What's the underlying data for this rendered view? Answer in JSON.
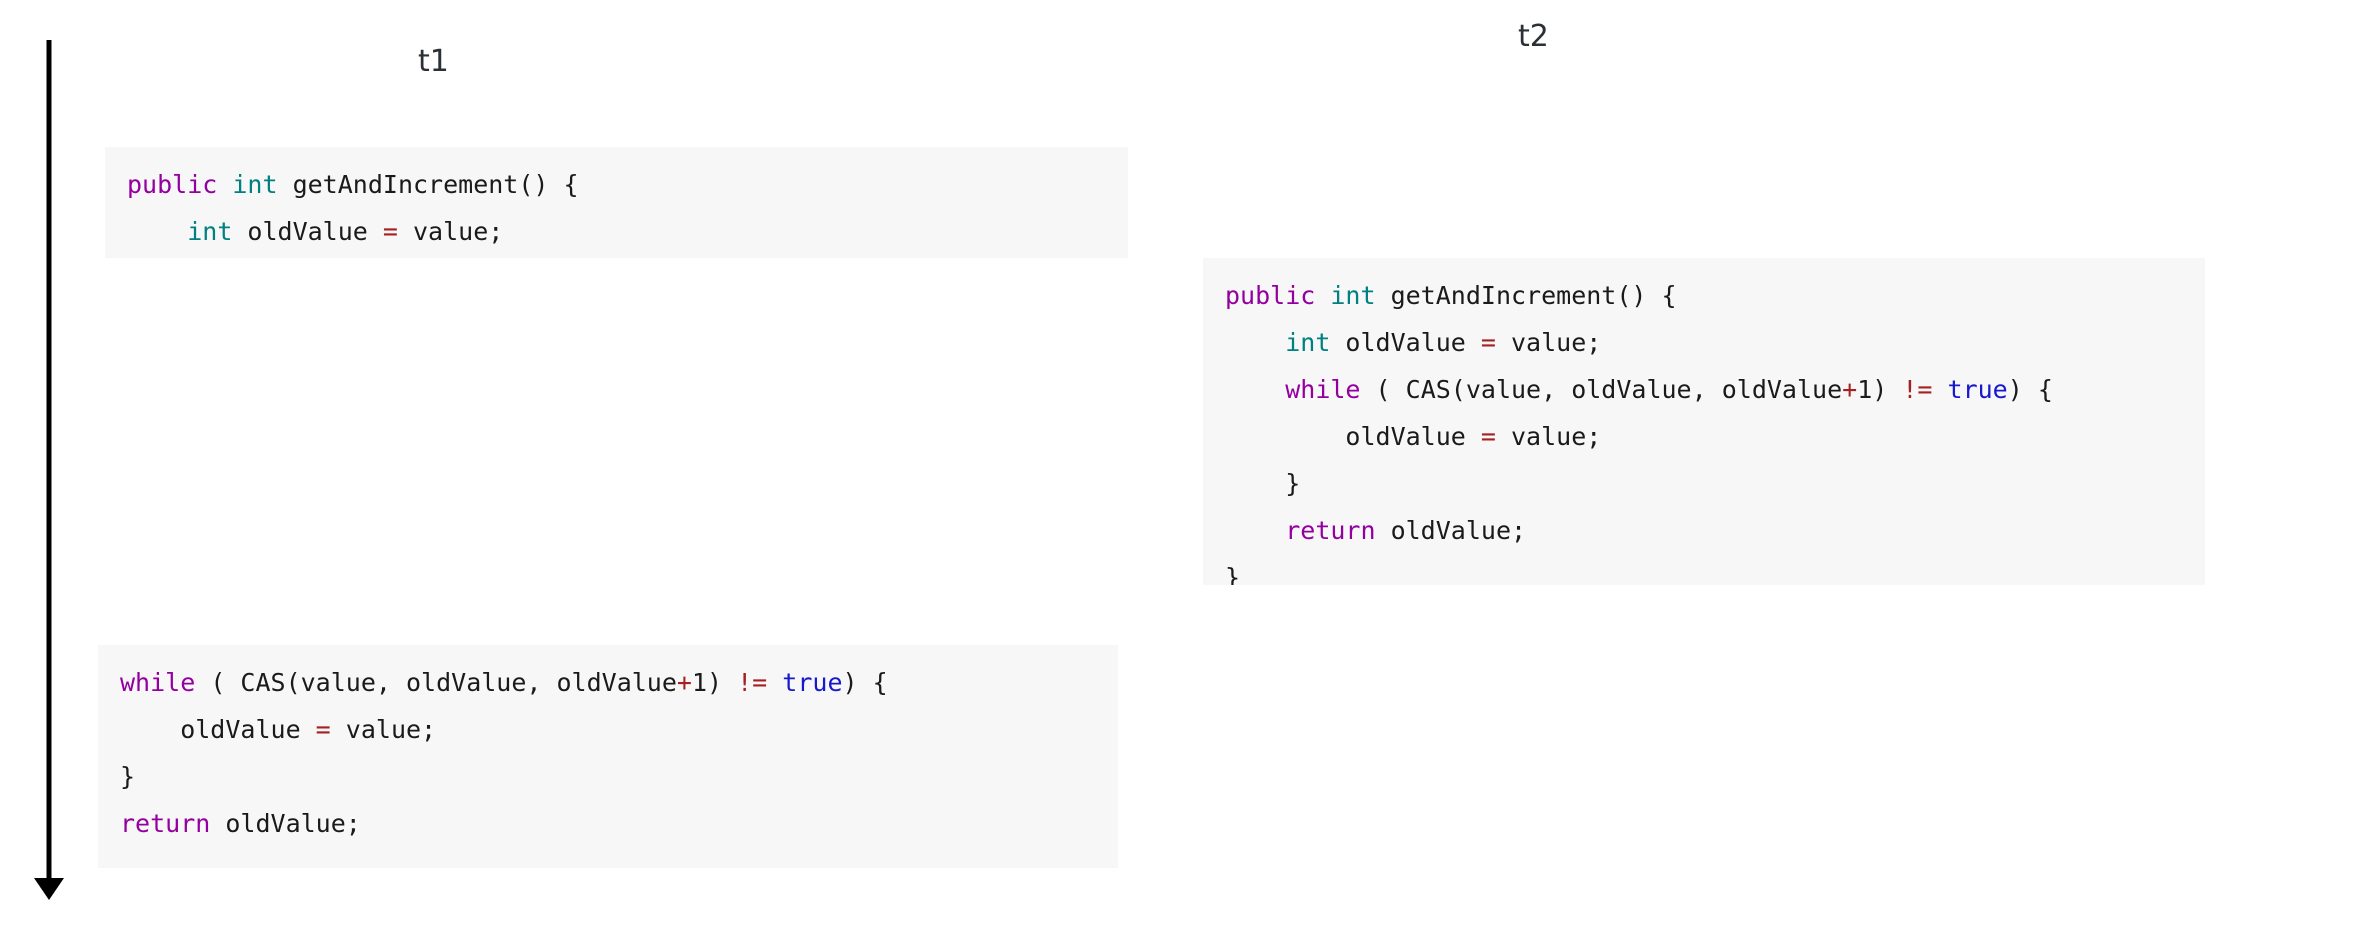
{
  "figure": {
    "type": "thread-interleaving-diagram",
    "background_color": "#ffffff",
    "code_block_background": "#f7f7f7"
  },
  "timeline": {
    "name": "time-arrow",
    "direction": "downward",
    "color": "#000000"
  },
  "threads": [
    {
      "id": "t1",
      "label": "t1"
    },
    {
      "id": "t2",
      "label": "t2"
    }
  ],
  "syntax_colors": {
    "keyword": "#9400a0",
    "type": "#008080",
    "operator": "#a52020",
    "literal": "#1818cc",
    "identifier": "#1a1a1a",
    "background": "#f7f7f7"
  },
  "code_blocks": [
    {
      "id": "code-t1-a",
      "thread": "t1",
      "language": "java",
      "lines": [
        [
          {
            "t": "public",
            "c": "kw"
          },
          {
            "t": " ",
            "c": "id"
          },
          {
            "t": "int",
            "c": "type"
          },
          {
            "t": " getAndIncrement() {",
            "c": "id"
          }
        ],
        [
          {
            "t": "    ",
            "c": "id"
          },
          {
            "t": "int",
            "c": "type"
          },
          {
            "t": " oldValue ",
            "c": "id"
          },
          {
            "t": "=",
            "c": "op"
          },
          {
            "t": " value;",
            "c": "id"
          }
        ]
      ]
    },
    {
      "id": "code-t2",
      "thread": "t2",
      "language": "java",
      "lines": [
        [
          {
            "t": "public",
            "c": "kw"
          },
          {
            "t": " ",
            "c": "id"
          },
          {
            "t": "int",
            "c": "type"
          },
          {
            "t": " getAndIncrement() {",
            "c": "id"
          }
        ],
        [
          {
            "t": "    ",
            "c": "id"
          },
          {
            "t": "int",
            "c": "type"
          },
          {
            "t": " oldValue ",
            "c": "id"
          },
          {
            "t": "=",
            "c": "op"
          },
          {
            "t": " value;",
            "c": "id"
          }
        ],
        [
          {
            "t": "    ",
            "c": "id"
          },
          {
            "t": "while",
            "c": "kw"
          },
          {
            "t": " ( CAS(value, oldValue, oldValue",
            "c": "id"
          },
          {
            "t": "+",
            "c": "op"
          },
          {
            "t": "1) ",
            "c": "id"
          },
          {
            "t": "!=",
            "c": "op"
          },
          {
            "t": " ",
            "c": "id"
          },
          {
            "t": "true",
            "c": "lit"
          },
          {
            "t": ") {",
            "c": "id"
          }
        ],
        [
          {
            "t": "        oldValue ",
            "c": "id"
          },
          {
            "t": "=",
            "c": "op"
          },
          {
            "t": " value;",
            "c": "id"
          }
        ],
        [
          {
            "t": "    }",
            "c": "id"
          }
        ],
        [
          {
            "t": "    ",
            "c": "id"
          },
          {
            "t": "return",
            "c": "kw"
          },
          {
            "t": " oldValue;",
            "c": "id"
          }
        ],
        [
          {
            "t": "}",
            "c": "id"
          }
        ]
      ]
    },
    {
      "id": "code-t1-b",
      "thread": "t1",
      "language": "java",
      "lines": [
        [
          {
            "t": "while",
            "c": "kw"
          },
          {
            "t": " ( CAS(value, oldValue, oldValue",
            "c": "id"
          },
          {
            "t": "+",
            "c": "op"
          },
          {
            "t": "1) ",
            "c": "id"
          },
          {
            "t": "!=",
            "c": "op"
          },
          {
            "t": " ",
            "c": "id"
          },
          {
            "t": "true",
            "c": "lit"
          },
          {
            "t": ") {",
            "c": "id"
          }
        ],
        [
          {
            "t": "    oldValue ",
            "c": "id"
          },
          {
            "t": "=",
            "c": "op"
          },
          {
            "t": " value;",
            "c": "id"
          }
        ],
        [
          {
            "t": "}",
            "c": "id"
          }
        ],
        [
          {
            "t": "return",
            "c": "kw"
          },
          {
            "t": " oldValue;",
            "c": "id"
          }
        ]
      ]
    }
  ]
}
